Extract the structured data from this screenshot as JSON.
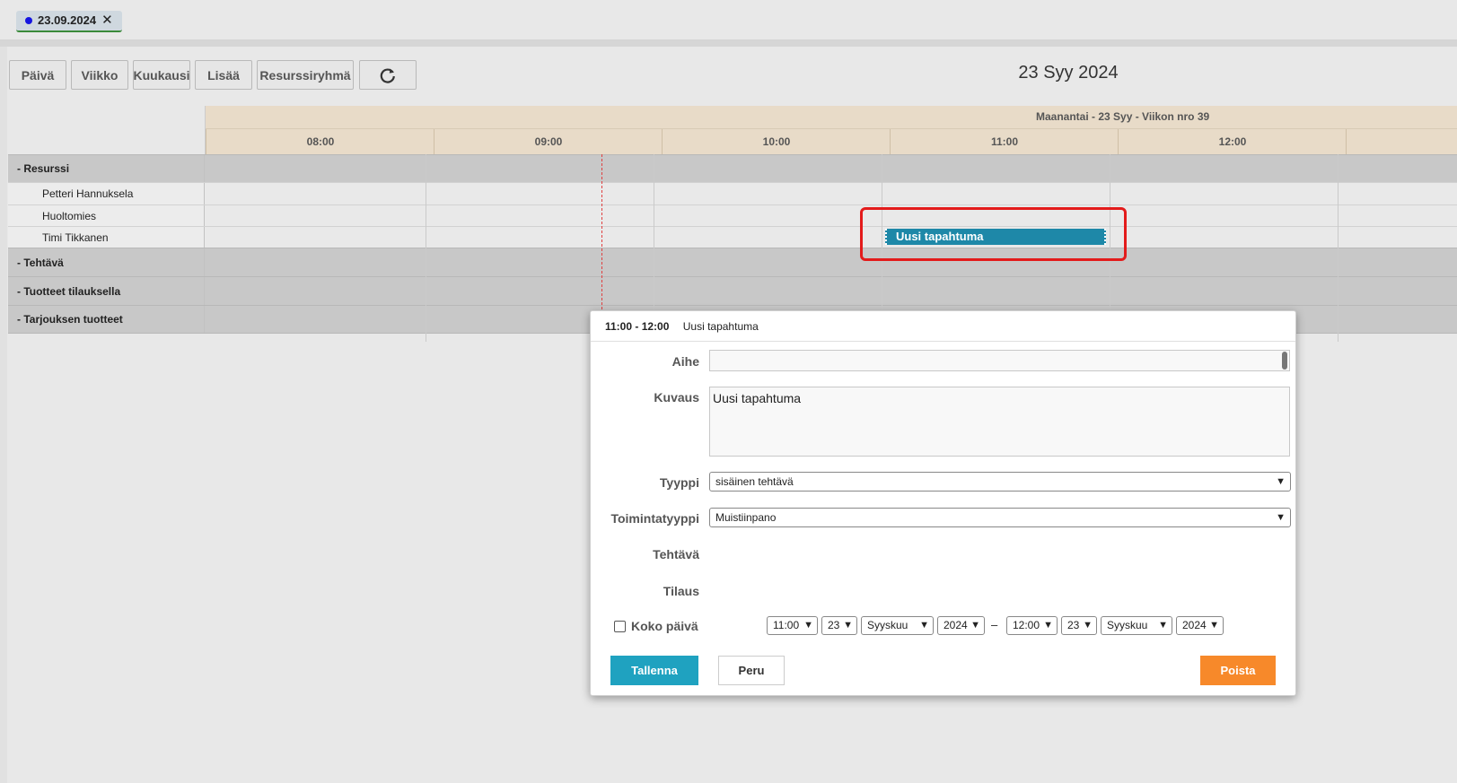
{
  "tab": {
    "label": "23.09.2024",
    "close": "✕"
  },
  "toolbar": {
    "day": "Päivä",
    "week": "Viikko",
    "month": "Kuukausi",
    "more": "Lisää",
    "resource_group": "Resurssiryhmä",
    "refresh_icon": "refresh-icon"
  },
  "date_title": "23 Syy 2024",
  "scheduler": {
    "day_header": "Maanantai - 23 Syy - Viikon nro 39",
    "hours": [
      "08:00",
      "09:00",
      "10:00",
      "11:00",
      "12:00"
    ],
    "rows": [
      {
        "type": "group",
        "label": "-  Resurssi"
      },
      {
        "type": "resource",
        "label": "Petteri Hannuksela"
      },
      {
        "type": "resource",
        "label": "Huoltomies"
      },
      {
        "type": "resource",
        "label": "Timi Tikkanen"
      },
      {
        "type": "group",
        "label": "-  Tehtävä"
      },
      {
        "type": "group",
        "label": "-  Tuotteet tilauksella"
      },
      {
        "type": "group",
        "label": "-  Tarjouksen tuotteet"
      }
    ],
    "event": {
      "title": "Uusi tapahtuma",
      "color": "#1e88a8"
    }
  },
  "dialog": {
    "time_range": "11:00 - 12:00",
    "title": "Uusi tapahtuma",
    "subject_label": "Aihe",
    "subject_value": "",
    "description_label": "Kuvaus",
    "description_value": "Uusi tapahtuma",
    "type_label": "Tyyppi",
    "type_value": "sisäinen tehtävä",
    "action_type_label": "Toimintatyyppi",
    "action_type_value": "Muistiinpano",
    "task_label": "Tehtävä",
    "order_label": "Tilaus",
    "all_day_label": "Koko päivä",
    "start": {
      "time": "11:00",
      "day": "23",
      "month": "Syyskuu",
      "year": "2024"
    },
    "dash": "–",
    "end": {
      "time": "12:00",
      "day": "23",
      "month": "Syyskuu",
      "year": "2024"
    },
    "save": "Tallenna",
    "cancel": "Peru",
    "delete": "Poista",
    "colors": {
      "save": "#1fa2c0",
      "delete": "#f7892a"
    }
  }
}
